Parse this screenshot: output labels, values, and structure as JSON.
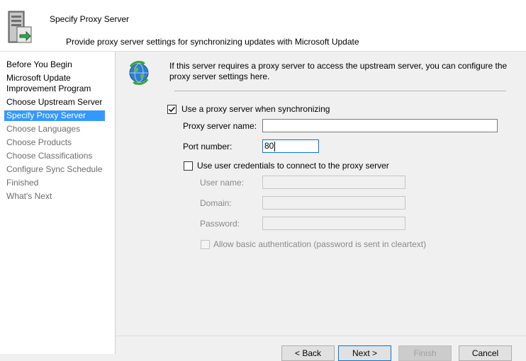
{
  "header": {
    "title": "Specify Proxy Server",
    "subtitle": "Provide proxy server settings for synchronizing updates with Microsoft Update"
  },
  "steps": [
    {
      "label": "Before You Begin",
      "state": "done"
    },
    {
      "label": "Microsoft Update Improvement Program",
      "state": "done"
    },
    {
      "label": "Choose Upstream Server",
      "state": "done"
    },
    {
      "label": "Specify Proxy Server",
      "state": "selected"
    },
    {
      "label": "Choose Languages",
      "state": "pending"
    },
    {
      "label": "Choose Products",
      "state": "pending"
    },
    {
      "label": "Choose Classifications",
      "state": "pending"
    },
    {
      "label": "Configure Sync Schedule",
      "state": "pending"
    },
    {
      "label": "Finished",
      "state": "pending"
    },
    {
      "label": "What's Next",
      "state": "pending"
    }
  ],
  "main": {
    "intro": "If this server requires a proxy server to access the upstream server, you can configure the proxy server settings here.",
    "use_proxy": {
      "label": "Use a proxy server when synchronizing",
      "checked": true
    },
    "proxy_name": {
      "label": "Proxy server name:",
      "value": ""
    },
    "port": {
      "label": "Port number:",
      "value": "80"
    },
    "use_credentials": {
      "label": "Use user credentials to connect to the proxy server",
      "checked": false
    },
    "user_name": {
      "label": "User name:",
      "value": ""
    },
    "domain": {
      "label": "Domain:",
      "value": ""
    },
    "password": {
      "label": "Password:",
      "value": ""
    },
    "basic_auth": {
      "label": "Allow basic authentication (password is sent in cleartext)",
      "checked": false
    }
  },
  "buttons": {
    "back": "< Back",
    "next": "Next >",
    "finish": "Finish",
    "cancel": "Cancel"
  },
  "icons": {
    "header": "server-sync-icon",
    "intro": "globe-sync-icon"
  },
  "colors": {
    "selection": "#3399ff",
    "focus_border": "#0078d7"
  }
}
